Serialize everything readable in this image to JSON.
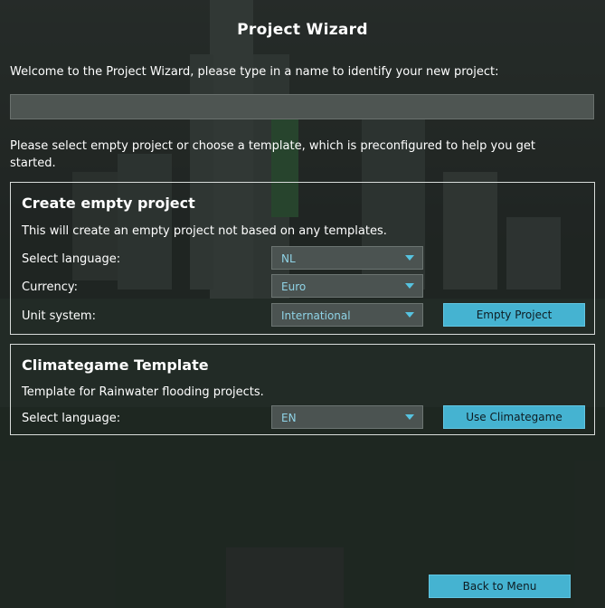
{
  "wizard": {
    "title": "Project Wizard",
    "intro": "Welcome to the Project Wizard, please type in a name to identify your new project:",
    "project_name_value": "",
    "select_note": "Please select empty project or choose a template, which is preconfigured to help you get started."
  },
  "empty_project": {
    "title": "Create empty project",
    "description": "This will create an empty project not based on any templates.",
    "language_label": "Select language:",
    "language_value": "NL",
    "currency_label": "Currency:",
    "currency_value": "Euro",
    "unit_label": "Unit system:",
    "unit_value": "International",
    "button_label": "Empty Project"
  },
  "climategame": {
    "title": "Climategame Template",
    "description": "Template for Rainwater flooding projects.",
    "language_label": "Select language:",
    "language_value": "EN",
    "button_label": "Use Climategame"
  },
  "footer": {
    "back_label": "Back to Menu"
  },
  "colors": {
    "accent": "#45b3d1",
    "dropdown_text": "#8fd3e6"
  }
}
